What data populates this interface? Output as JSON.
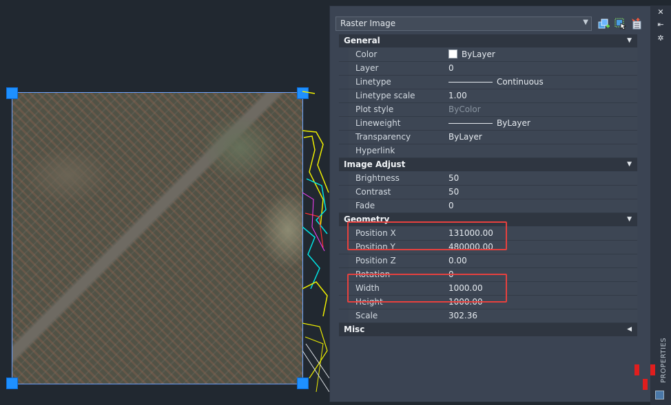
{
  "palette": {
    "object_type": "Raster Image",
    "side_label": "PROPERTIES",
    "sections": {
      "general": {
        "title": "General",
        "rows": {
          "color": {
            "label": "Color",
            "value": "ByLayer"
          },
          "layer": {
            "label": "Layer",
            "value": "0"
          },
          "linetype": {
            "label": "Linetype",
            "value": "Continuous"
          },
          "linetype_scale": {
            "label": "Linetype scale",
            "value": "1.00"
          },
          "plot_style": {
            "label": "Plot style",
            "value": "ByColor"
          },
          "lineweight": {
            "label": "Lineweight",
            "value": "ByLayer"
          },
          "transparency": {
            "label": "Transparency",
            "value": "ByLayer"
          },
          "hyperlink": {
            "label": "Hyperlink",
            "value": ""
          }
        }
      },
      "image_adjust": {
        "title": "Image Adjust",
        "rows": {
          "brightness": {
            "label": "Brightness",
            "value": "50"
          },
          "contrast": {
            "label": "Contrast",
            "value": "50"
          },
          "fade": {
            "label": "Fade",
            "value": "0"
          }
        }
      },
      "geometry": {
        "title": "Geometry",
        "rows": {
          "position_x": {
            "label": "Position X",
            "value": "131000.00"
          },
          "position_y": {
            "label": "Position Y",
            "value": "480000.00"
          },
          "position_z": {
            "label": "Position Z",
            "value": "0.00"
          },
          "rotation": {
            "label": "Rotation",
            "value": "0"
          },
          "width": {
            "label": "Width",
            "value": "1000.00"
          },
          "height": {
            "label": "Height",
            "value": "1000.00"
          },
          "scale": {
            "label": "Scale",
            "value": "302.36"
          }
        }
      },
      "misc": {
        "title": "Misc"
      }
    },
    "icons": {
      "quick_select": "quick-select-icon",
      "select_objects": "select-objects-icon",
      "toggle_pickadd": "toggle-pickadd-icon",
      "close": "close-icon",
      "autohide": "autohide-icon",
      "settings": "properties-settings-icon"
    },
    "colors": {
      "highlight": "#e8413e",
      "grip": "#1e90ff",
      "panel_bg": "#3b4453",
      "drawing_bg": "#212830"
    }
  }
}
